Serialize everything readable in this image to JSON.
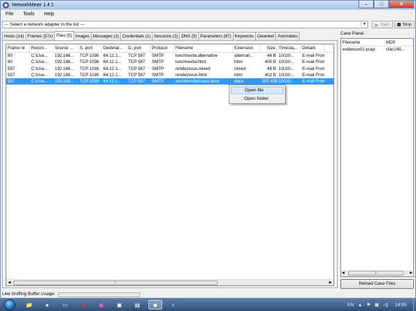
{
  "window": {
    "title": "NetworkMiner 1.4.1"
  },
  "menu": [
    "File",
    "Tools",
    "Help"
  ],
  "toolbar": {
    "adapter_text": "--- Select a network adapter in the list ---",
    "start_label": "Start",
    "stop_label": "Stop"
  },
  "tabs": [
    {
      "label": "Hosts (14)",
      "active": false
    },
    {
      "label": "Frames (57x)",
      "active": false
    },
    {
      "label": "Files (5)",
      "active": true
    },
    {
      "label": "Images",
      "active": false
    },
    {
      "label": "Messages (2)",
      "active": false
    },
    {
      "label": "Credentials (1)",
      "active": false
    },
    {
      "label": "Sessions (2)",
      "active": false
    },
    {
      "label": "DNS (9)",
      "active": false
    },
    {
      "label": "Parameters (67)",
      "active": false
    },
    {
      "label": "Keywords",
      "active": false
    },
    {
      "label": "Cleartext",
      "active": false
    },
    {
      "label": "Anomalies",
      "active": false
    }
  ],
  "files_table": {
    "columns": [
      "Frame nr.",
      "Recon...",
      "Source ...",
      "S. port",
      "Destinat...",
      "D. port",
      "Protocol",
      "Filename",
      "Extension",
      "Size",
      "Timesta...",
      "Details"
    ],
    "rows": [
      [
        "80",
        "C:\\Use...",
        "192.168...",
        "TCP 1036",
        "64.12.1...",
        "TCP 587",
        "SMTP",
        "lunchnextw.alternative",
        "alternati...",
        "46 B",
        "10/10/...",
        "E-mail From"
      ],
      [
        "80",
        "C:\\Use...",
        "192.168...",
        "TCP 1036",
        "64.12.1...",
        "TCP 587",
        "SMTP",
        "lunchnextw.html",
        "html",
        "400 B",
        "10/10/...",
        "E-mail From"
      ],
      [
        "557",
        "C:\\Use...",
        "192.168...",
        "TCP 1038",
        "64.12.1...",
        "TCP 587",
        "SMTP",
        "rendezvous.mixed",
        "mixed",
        "46 B",
        "10/10/...",
        "E-mail From"
      ],
      [
        "557",
        "C:\\Use...",
        "192.168...",
        "TCP 1038",
        "64.12.1...",
        "TCP 587",
        "SMTP",
        "rendezvous.html",
        "html",
        "402 B",
        "10/10/...",
        "E-mail From"
      ],
      [
        "557",
        "C:\\Use...",
        "192.168...",
        "TCP 1038",
        "64.12.1...",
        "TCP 587",
        "SMTP",
        "secretrendezvous.docx",
        "docx",
        "307 435 ...",
        "10/10/...",
        "E-mail From"
      ]
    ],
    "selected_row": 4
  },
  "context_menu": {
    "items": [
      "Open file",
      "Open folder"
    ]
  },
  "case_panel": {
    "title": "Case Panel",
    "columns": [
      "Filename",
      "MD5"
    ],
    "rows": [
      [
        "evidence02.pcap",
        "cfac149..."
      ]
    ],
    "reload_label": "Reload Case Files"
  },
  "status": {
    "buffer_label": "Live Sniffing Buffer Usage:"
  },
  "taskbar": {
    "lang": "EN",
    "time": "14:55"
  },
  "colors": {
    "selection": "#3399ff",
    "title_gradient_top": "#cfe0f5",
    "close_button": "#c7402b",
    "taskbar": "#2f4f74"
  }
}
